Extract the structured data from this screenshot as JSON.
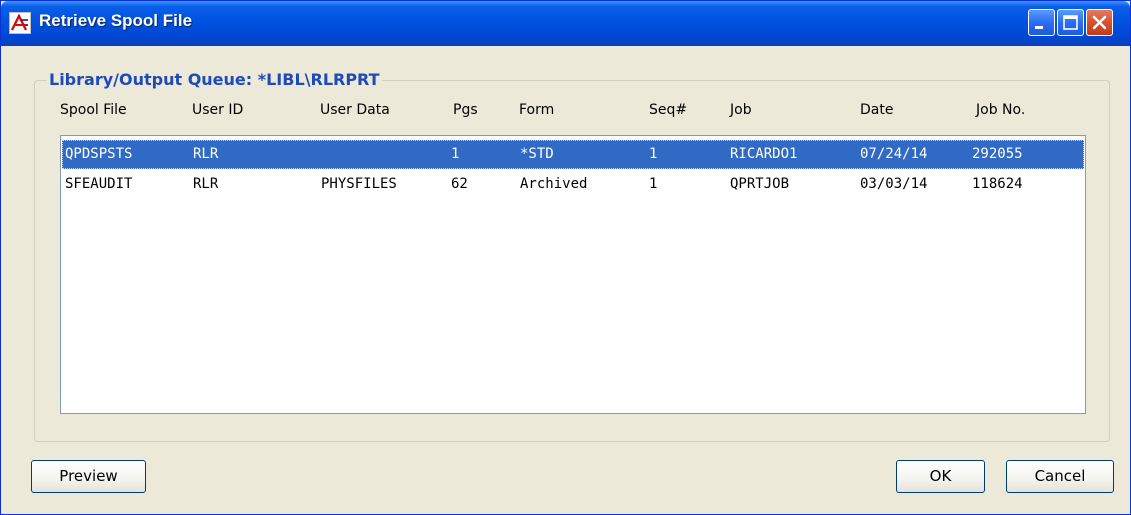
{
  "window": {
    "title": "Retrieve Spool File",
    "titlebar_color": "#0a5fe8"
  },
  "group": {
    "legend": "Library/Output Queue: *LIBL\\RLRPRT"
  },
  "columns": [
    "Spool File",
    "User ID",
    "User Data",
    "Pgs",
    "Form",
    "Seq#",
    "Job",
    "Date",
    "Job No."
  ],
  "rows": [
    {
      "selected": true,
      "cells": [
        "QPDSPSTS",
        "RLR",
        "",
        "1",
        "*STD",
        "1",
        "RICARDO1",
        "07/24/14",
        "292055"
      ]
    },
    {
      "selected": false,
      "cells": [
        "SFEAUDIT",
        "RLR",
        "PHYSFILES",
        "62",
        "Archived",
        "1",
        "QPRTJOB",
        "03/03/14",
        "118624"
      ]
    }
  ],
  "buttons": {
    "preview": "Preview",
    "ok": "OK",
    "cancel": "Cancel"
  },
  "colors": {
    "selection": "#316ac5",
    "legend_text": "#1f4ab8"
  }
}
